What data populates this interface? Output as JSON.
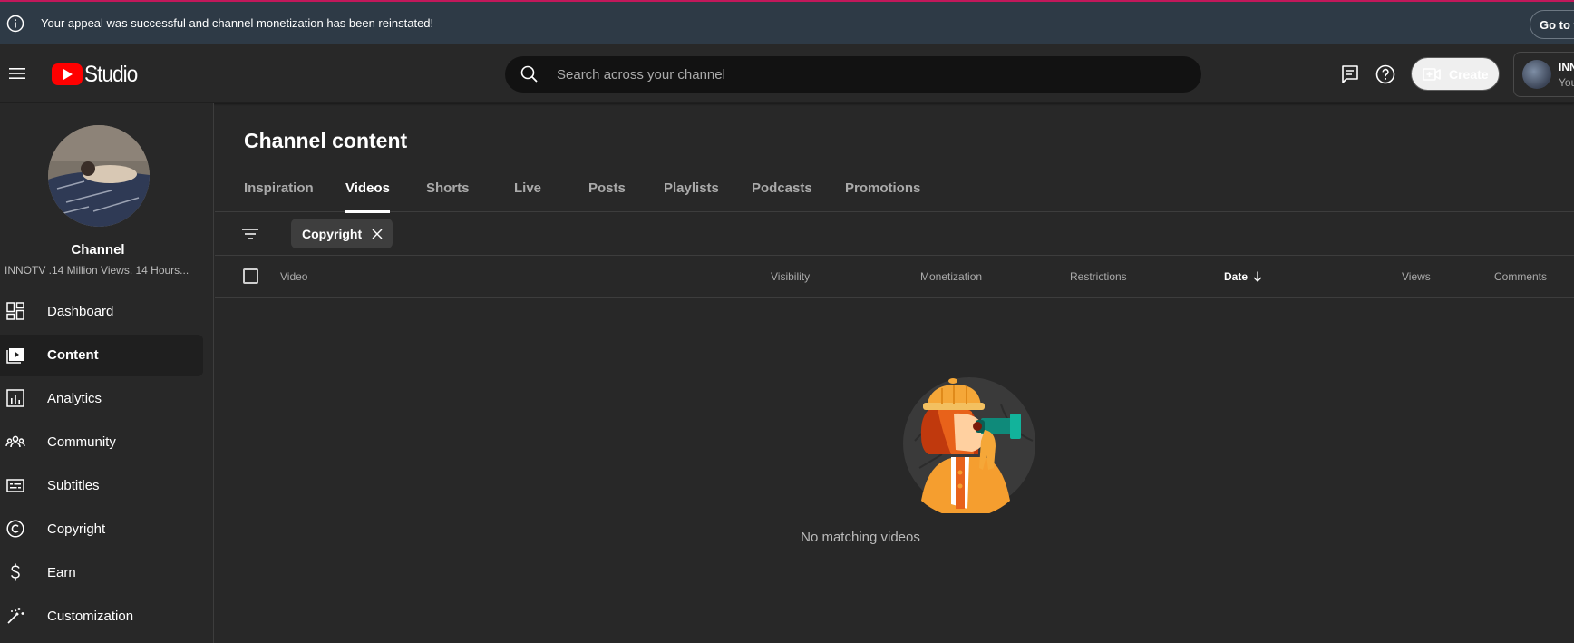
{
  "banner": {
    "message": "Your appeal was successful and channel monetization has been reinstated!",
    "action_label": "Go to y"
  },
  "header": {
    "logo_text": "Studio",
    "search_placeholder": "Search across your channel",
    "create_label": "Create",
    "account_name": "INN",
    "account_sub": "You"
  },
  "sidebar": {
    "channel_label": "Channel",
    "channel_desc": "INNOTV .14 Million Views. 14 Hours...",
    "items": [
      {
        "label": "Dashboard",
        "icon": "dashboard-icon"
      },
      {
        "label": "Content",
        "icon": "content-icon",
        "active": true
      },
      {
        "label": "Analytics",
        "icon": "analytics-icon"
      },
      {
        "label": "Community",
        "icon": "community-icon"
      },
      {
        "label": "Subtitles",
        "icon": "subtitles-icon"
      },
      {
        "label": "Copyright",
        "icon": "copyright-icon"
      },
      {
        "label": "Earn",
        "icon": "earn-icon"
      },
      {
        "label": "Customization",
        "icon": "customization-icon"
      }
    ]
  },
  "main": {
    "title": "Channel content",
    "tabs": [
      {
        "label": "Inspiration"
      },
      {
        "label": "Videos",
        "active": true
      },
      {
        "label": "Shorts"
      },
      {
        "label": "Live"
      },
      {
        "label": "Posts"
      },
      {
        "label": "Playlists"
      },
      {
        "label": "Podcasts"
      },
      {
        "label": "Promotions"
      }
    ],
    "filter_chip": "Copyright",
    "columns": [
      "Video",
      "Visibility",
      "Monetization",
      "Restrictions",
      "Date",
      "Views",
      "Comments"
    ],
    "sorted_column": "Date",
    "empty_message": "No matching videos"
  },
  "colors": {
    "background": "#282828",
    "banner": "#2e3a46",
    "brand_red": "#ff0000",
    "search_bg": "#121212"
  }
}
